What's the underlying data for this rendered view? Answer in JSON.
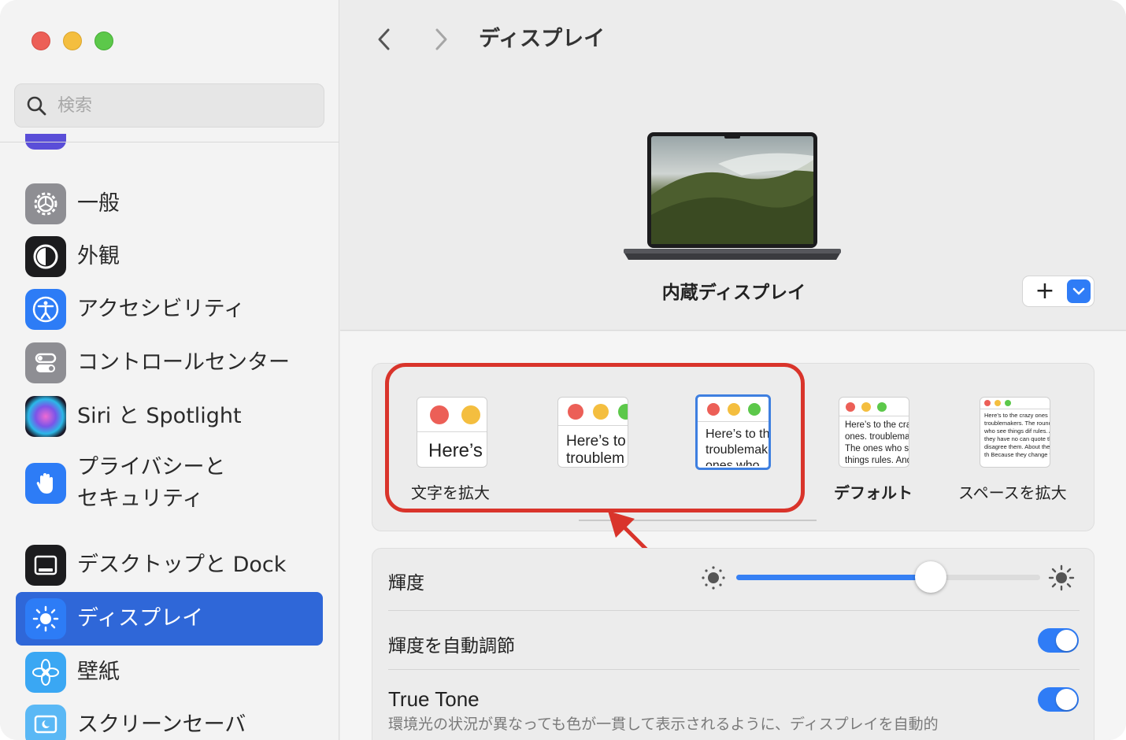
{
  "window": {
    "traffic_lights": [
      "close",
      "minimize",
      "zoom"
    ]
  },
  "sidebar": {
    "search_placeholder": "検索",
    "items": [
      {
        "label": "一般",
        "icon": "gear-icon",
        "color": "#8e8e93"
      },
      {
        "label": "外観",
        "icon": "appearance-icon",
        "color": "#1c1c1e"
      },
      {
        "label": "アクセシビリティ",
        "icon": "accessibility-icon",
        "color": "#2d7cf6"
      },
      {
        "label": "コントロールセンター",
        "icon": "control-center-icon",
        "color": "#8e8e93"
      },
      {
        "label": "Siri と Spotlight",
        "icon": "siri-icon",
        "color": "#2b2b40"
      },
      {
        "label": "プライバシーと\nセキュリティ",
        "label_line1": "プライバシーと",
        "label_line2": "セキュリティ",
        "icon": "hand-icon",
        "color": "#2d7cf6"
      },
      {
        "label": "デスクトップと Dock",
        "icon": "dock-icon",
        "color": "#1c1c1e"
      },
      {
        "label": "ディスプレイ",
        "icon": "brightness-icon",
        "color": "#2d7cf6",
        "selected": true
      },
      {
        "label": "壁紙",
        "icon": "wallpaper-icon",
        "color": "#3aa7f3"
      },
      {
        "label": "スクリーンセーバ",
        "icon": "screensaver-icon",
        "color": "#5ab8f5"
      }
    ]
  },
  "header": {
    "back_icon": "chevron-left-icon",
    "forward_icon": "chevron-right-icon",
    "title": "ディスプレイ"
  },
  "display": {
    "name": "内蔵ディスプレイ",
    "add_symbol": "+",
    "dropdown_icon": "chevron-down-icon"
  },
  "resolution": {
    "options": [
      {
        "label": "文字を拡大",
        "preview": "Here’s",
        "selected": false
      },
      {
        "label": "",
        "preview": "Here’s to troublem",
        "selected": false
      },
      {
        "label": "",
        "preview": "Here’s to the troublemakers. ones who",
        "selected": true
      },
      {
        "label": "デフォルト",
        "preview": "Here’s to the crazy ones. troublemakers. The ones who see things rules. And they",
        "selected": false
      },
      {
        "label": "スペースを拡大",
        "preview": "Here’s to the crazy ones troublemakers. The round ones who see things dif rules. And they have no can quote them, disagree them. About the only th Because they change th",
        "selected": false
      }
    ],
    "accent_color": "#3e7fe0",
    "annotation_color": "#d9342b"
  },
  "settings": {
    "brightness": {
      "label": "輝度",
      "value": 0.64
    },
    "auto_brightness": {
      "label": "輝度を自動調節",
      "on": true
    },
    "true_tone": {
      "label": "True Tone",
      "on": true,
      "description": "環境光の状況が異なっても色が一貫して表示されるように、ディスプレイを自動的"
    }
  }
}
